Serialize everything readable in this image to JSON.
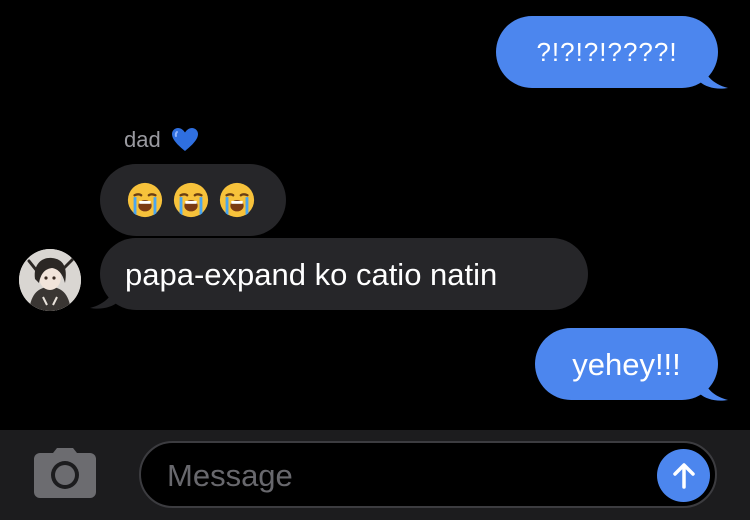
{
  "thread": {
    "messages": [
      {
        "direction": "outgoing",
        "text": "?!?!?!????!"
      },
      {
        "direction": "incoming",
        "sender": "dad",
        "sender_badge_icon": "blue-heart-icon",
        "emoji": [
          "loudly-crying-face",
          "loudly-crying-face",
          "loudly-crying-face"
        ]
      },
      {
        "direction": "incoming",
        "text": "papa-expand ko catio natin",
        "avatar_icon": "contact-avatar"
      },
      {
        "direction": "outgoing",
        "text": "yehey!!!"
      }
    ]
  },
  "composer": {
    "placeholder": "Message",
    "camera_icon": "camera-icon",
    "send_icon": "arrow-up-icon"
  },
  "colors": {
    "background": "#000000",
    "outgoing_bubble": "#4c86ee",
    "incoming_bubble": "#262629",
    "composer_bar": "#1c1c1e",
    "placeholder_text": "#68686d",
    "sender_name": "#9a9aa0"
  }
}
